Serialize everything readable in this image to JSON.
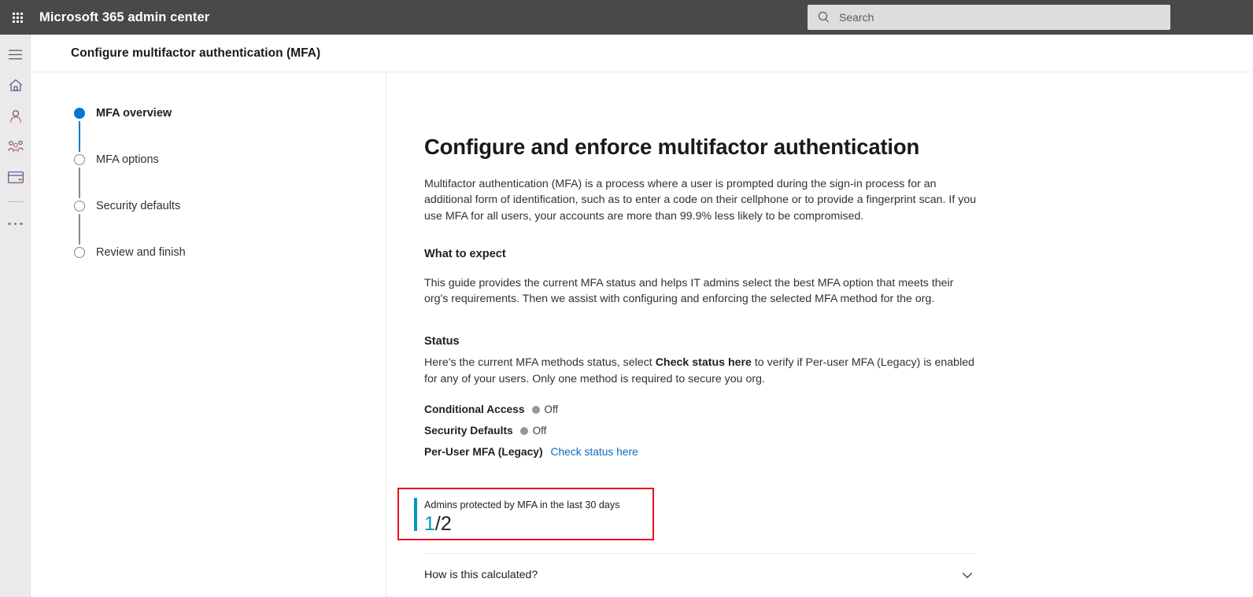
{
  "suite": {
    "waffle_icon": "app-launcher-waffle-icon",
    "title": "Microsoft 365 admin center",
    "search_placeholder": "Search",
    "search_value": "",
    "search_icon": "search-icon",
    "bar_color": "#4a4947"
  },
  "rail": {
    "items": [
      {
        "icon": "hamburger-menu-icon",
        "name": "menu"
      },
      {
        "icon": "home-icon",
        "name": "home"
      },
      {
        "icon": "person-icon",
        "name": "users"
      },
      {
        "icon": "people-group-icon",
        "name": "teams-groups"
      },
      {
        "icon": "billing-card-icon",
        "name": "billing"
      },
      {
        "icon": "ellipsis-icon",
        "name": "show-all"
      }
    ]
  },
  "page": {
    "header_title": "Configure multifactor authentication (MFA)"
  },
  "wizard": {
    "steps": [
      {
        "label": "MFA overview",
        "state": "active"
      },
      {
        "label": "MFA options",
        "state": "pending"
      },
      {
        "label": "Security defaults",
        "state": "pending"
      },
      {
        "label": "Review and finish",
        "state": "pending"
      }
    ],
    "active_color": "#0078d4",
    "pending_color": "#8a8886"
  },
  "main": {
    "title": "Configure and enforce multifactor authentication",
    "intro": "Multifactor authentication (MFA) is a process where a user is prompted during the sign-in process for an additional form of identification, such as to enter a code on their cellphone or to provide a fingerprint scan. If you use MFA for all users, your accounts are more than 99.9% less likely to be compromised.",
    "what_to_expect_title": "What to expect",
    "what_to_expect_body": "This guide provides the current MFA status and helps IT admins select the best MFA option that meets their org's requirements. Then we assist with configuring and enforcing the selected MFA method for the org.",
    "status_title": "Status",
    "status_desc_part1": "Here's the current MFA methods status, select ",
    "status_desc_bold": "Check status here",
    "status_desc_part2": " to verify if Per-user MFA (Legacy) is enabled for any of your users. Only one method is required to secure you org.",
    "status_rows": [
      {
        "name": "Conditional Access",
        "value": "Off",
        "pip": "#979593",
        "type": "pip"
      },
      {
        "name": "Security Defaults",
        "value": "Off",
        "pip": "#979593",
        "type": "pip"
      },
      {
        "name": "Per-User MFA (Legacy)",
        "link": "Check status here",
        "type": "link"
      }
    ],
    "metric": {
      "label": "Admins protected by MFA in the last 30 days",
      "numerator": "1",
      "denominator": "/2",
      "accent_color": "#0099bc",
      "highlight_color": "#e81123"
    },
    "expander": {
      "title": "How is this calculated?",
      "icon": "chevron-down-icon"
    }
  }
}
